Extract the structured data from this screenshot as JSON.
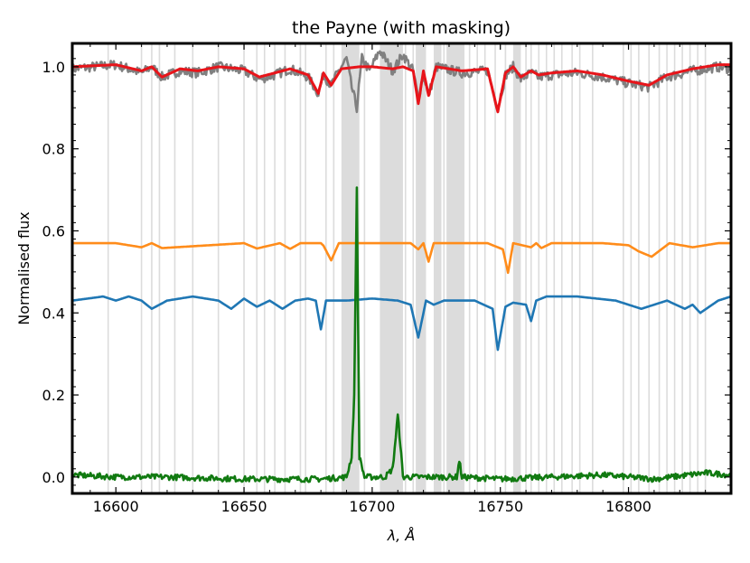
{
  "chart_data": {
    "type": "line",
    "title": "the Payne (with masking)",
    "xlabel": "λ, Å",
    "ylabel": "Normalised flux",
    "xlim": [
      16583,
      16840
    ],
    "ylim": [
      -0.04,
      1.057
    ],
    "xticks": [
      16600,
      16650,
      16700,
      16750,
      16800
    ],
    "yticks": [
      0.0,
      0.2,
      0.4,
      0.6,
      0.8,
      1.0
    ],
    "xtick_labels": [
      "16600",
      "16650",
      "16700",
      "16750",
      "16800"
    ],
    "ytick_labels": [
      "0.0",
      "0.2",
      "0.4",
      "0.6",
      "0.8",
      "1.0"
    ],
    "mask_color": "#dcdcdc",
    "mask_wide": [
      [
        16688,
        16695
      ],
      [
        16703,
        16712
      ],
      [
        16717,
        16721
      ],
      [
        16724,
        16727
      ],
      [
        16729,
        16736
      ],
      [
        16755,
        16758
      ]
    ],
    "mask_lines": [
      16597,
      16610,
      16614,
      16617,
      16623,
      16630,
      16640,
      16650,
      16655,
      16658,
      16662,
      16666,
      16672,
      16674,
      16682,
      16685,
      16697,
      16713,
      16716,
      16728,
      16738,
      16741,
      16744,
      16748,
      16752,
      16760,
      16762,
      16765,
      16768,
      16771,
      16774,
      16778,
      16781,
      16786,
      16798,
      16801,
      16804,
      16808,
      16812,
      16815,
      16818,
      16821,
      16824,
      16827,
      16830
    ],
    "series": [
      {
        "color": "#808080",
        "width": 2.6,
        "noise": 0.012,
        "x": [
          16583,
          16600,
          16610,
          16614,
          16618,
          16625,
          16632,
          16640,
          16650,
          16656,
          16662,
          16668,
          16675,
          16679,
          16681,
          16684,
          16687,
          16690,
          16692,
          16694,
          16696,
          16699,
          16703,
          16708,
          16712,
          16716,
          16718,
          16720,
          16722,
          16725,
          16735,
          16745,
          16749,
          16752,
          16755,
          16758,
          16762,
          16765,
          16770,
          16780,
          16790,
          16800,
          16808,
          16815,
          16825,
          16835,
          16840
        ],
        "y": [
          0.995,
          1.005,
          0.985,
          1.0,
          0.975,
          0.99,
          0.985,
          1.0,
          0.99,
          0.97,
          0.98,
          0.995,
          0.975,
          0.935,
          0.98,
          0.955,
          0.99,
          1.02,
          0.95,
          0.9,
          1.02,
          0.99,
          1.04,
          0.99,
          1.03,
          0.99,
          0.92,
          0.985,
          0.93,
          1.0,
          0.985,
          0.99,
          0.9,
          0.98,
          1.0,
          0.97,
          0.985,
          0.975,
          0.98,
          0.985,
          0.975,
          0.96,
          0.95,
          0.975,
          0.99,
          1.0,
          0.995
        ]
      },
      {
        "color": "#e8141a",
        "width": 3,
        "x": [
          16583,
          16600,
          16610,
          16614,
          16618,
          16625,
          16632,
          16640,
          16650,
          16656,
          16662,
          16668,
          16675,
          16679,
          16681,
          16684,
          16688,
          16695,
          16700,
          16708,
          16712,
          16716,
          16718,
          16720,
          16722,
          16725,
          16735,
          16745,
          16749,
          16752,
          16755,
          16758,
          16762,
          16765,
          16770,
          16780,
          16790,
          16800,
          16808,
          16815,
          16825,
          16835,
          16840
        ],
        "y": [
          1.0,
          1.005,
          0.99,
          1.0,
          0.975,
          0.995,
          0.99,
          1.0,
          0.995,
          0.975,
          0.985,
          0.995,
          0.98,
          0.935,
          0.985,
          0.955,
          0.995,
          1.0,
          1.0,
          0.995,
          1.0,
          0.99,
          0.91,
          0.99,
          0.93,
          1.0,
          0.99,
          0.995,
          0.89,
          0.985,
          1.0,
          0.975,
          0.99,
          0.98,
          0.985,
          0.99,
          0.98,
          0.965,
          0.955,
          0.98,
          0.995,
          1.005,
          1.005
        ]
      },
      {
        "color": "#ff8c1a",
        "width": 2.6,
        "x": [
          16583,
          16600,
          16610,
          16614,
          16618,
          16650,
          16655,
          16664,
          16668,
          16672,
          16680,
          16681,
          16684,
          16687,
          16692,
          16700,
          16715,
          16718,
          16720,
          16722,
          16724,
          16730,
          16745,
          16751,
          16753,
          16755,
          16762,
          16764,
          16766,
          16770,
          16790,
          16800,
          16804,
          16809,
          16816,
          16825,
          16835,
          16840
        ],
        "y": [
          0.57,
          0.57,
          0.56,
          0.57,
          0.558,
          0.57,
          0.557,
          0.57,
          0.556,
          0.57,
          0.57,
          0.564,
          0.528,
          0.57,
          0.57,
          0.57,
          0.57,
          0.555,
          0.57,
          0.525,
          0.57,
          0.57,
          0.57,
          0.555,
          0.498,
          0.57,
          0.56,
          0.57,
          0.558,
          0.57,
          0.57,
          0.565,
          0.55,
          0.537,
          0.57,
          0.56,
          0.57,
          0.57
        ]
      },
      {
        "color": "#1f77b4",
        "width": 2.6,
        "x": [
          16583,
          16595,
          16600,
          16605,
          16610,
          16614,
          16620,
          16630,
          16640,
          16645,
          16650,
          16655,
          16660,
          16665,
          16670,
          16675,
          16678,
          16680,
          16682,
          16690,
          16700,
          16710,
          16715,
          16718,
          16721,
          16724,
          16728,
          16740,
          16747,
          16749,
          16752,
          16755,
          16760,
          16762,
          16764,
          16768,
          16780,
          16795,
          16805,
          16815,
          16822,
          16825,
          16828,
          16835,
          16840
        ],
        "y": [
          0.43,
          0.44,
          0.43,
          0.44,
          0.43,
          0.41,
          0.43,
          0.44,
          0.43,
          0.41,
          0.435,
          0.415,
          0.43,
          0.41,
          0.43,
          0.435,
          0.43,
          0.36,
          0.43,
          0.43,
          0.435,
          0.43,
          0.42,
          0.34,
          0.43,
          0.42,
          0.43,
          0.43,
          0.41,
          0.31,
          0.415,
          0.425,
          0.42,
          0.38,
          0.43,
          0.44,
          0.44,
          0.43,
          0.41,
          0.43,
          0.41,
          0.42,
          0.4,
          0.43,
          0.44
        ]
      },
      {
        "color": "#117a11",
        "width": 2.6,
        "noise": 0.007,
        "x": [
          16583,
          16600,
          16620,
          16650,
          16680,
          16690,
          16692,
          16693,
          16694,
          16695,
          16697,
          16705,
          16708,
          16710,
          16711,
          16712,
          16714,
          16725,
          16733,
          16734,
          16735,
          16750,
          16770,
          16790,
          16810,
          16830,
          16840
        ],
        "y": [
          0.005,
          0.0,
          0.0,
          -0.005,
          -0.005,
          0.0,
          0.05,
          0.2,
          0.7,
          0.05,
          0.0,
          0.0,
          0.02,
          0.15,
          0.08,
          0.0,
          0.0,
          0.0,
          0.0,
          0.04,
          0.0,
          -0.005,
          0.0,
          0.005,
          -0.005,
          0.01,
          0.005
        ]
      }
    ]
  }
}
